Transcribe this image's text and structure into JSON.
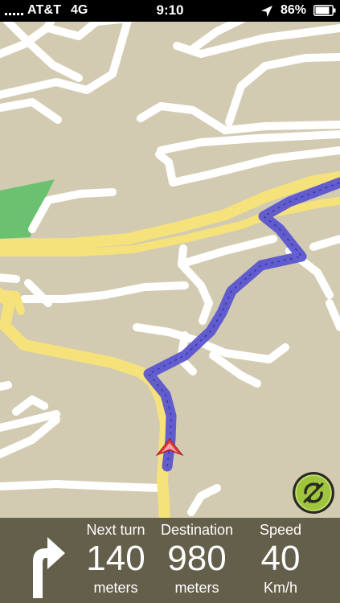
{
  "status_bar": {
    "carrier": "AT&T",
    "network": "4G",
    "time": "9:10",
    "battery": "86%",
    "icons": [
      "signal-bars-icon",
      "location-arrow-icon",
      "battery-icon"
    ]
  },
  "map": {
    "colors": {
      "land": "#d3cbb1",
      "street": "#ffffff",
      "major_road": "#f6e27a",
      "route": "#5752cf",
      "park": "#6cc170",
      "position_marker": "#e0383a"
    },
    "center_button_icon": "recenter-rotate-icon"
  },
  "panel": {
    "turn_icon": "turn-right-arrow-icon",
    "next_turn": {
      "label": "Next turn",
      "value": "140",
      "unit": "meters"
    },
    "destination": {
      "label": "Destination",
      "value": "980",
      "unit": "meters"
    },
    "speed": {
      "label": "Speed",
      "value": "40",
      "unit": "Km/h"
    }
  }
}
